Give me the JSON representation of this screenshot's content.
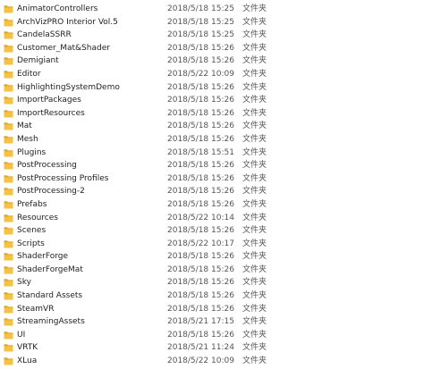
{
  "folder_icon": "folder-icon",
  "colors": {
    "folder_body": "#f5c242",
    "folder_back": "#e2a52b",
    "text": "#222222",
    "meta_text": "#555555",
    "hover": "#e5f3ff"
  },
  "files": [
    {
      "name": "AnimatorControllers",
      "date": "2018/5/18 15:25",
      "type": "文件夹"
    },
    {
      "name": "ArchVizPRO Interior Vol.5",
      "date": "2018/5/18 15:25",
      "type": "文件夹"
    },
    {
      "name": "CandelaSSRR",
      "date": "2018/5/18 15:25",
      "type": "文件夹"
    },
    {
      "name": "Customer_Mat&Shader",
      "date": "2018/5/18 15:26",
      "type": "文件夹"
    },
    {
      "name": "Demigiant",
      "date": "2018/5/18 15:26",
      "type": "文件夹"
    },
    {
      "name": "Editor",
      "date": "2018/5/22 10:09",
      "type": "文件夹"
    },
    {
      "name": "HighlightingSystemDemo",
      "date": "2018/5/18 15:26",
      "type": "文件夹"
    },
    {
      "name": "ImportPackages",
      "date": "2018/5/18 15:26",
      "type": "文件夹"
    },
    {
      "name": "ImportResources",
      "date": "2018/5/18 15:26",
      "type": "文件夹"
    },
    {
      "name": "Mat",
      "date": "2018/5/18 15:26",
      "type": "文件夹"
    },
    {
      "name": "Mesh",
      "date": "2018/5/18 15:26",
      "type": "文件夹"
    },
    {
      "name": "Plugins",
      "date": "2018/5/18 15:51",
      "type": "文件夹"
    },
    {
      "name": "PostProcessing",
      "date": "2018/5/18 15:26",
      "type": "文件夹"
    },
    {
      "name": "PostProcessing Profiles",
      "date": "2018/5/18 15:26",
      "type": "文件夹"
    },
    {
      "name": "PostProcessing-2",
      "date": "2018/5/18 15:26",
      "type": "文件夹"
    },
    {
      "name": "Prefabs",
      "date": "2018/5/18 15:26",
      "type": "文件夹"
    },
    {
      "name": "Resources",
      "date": "2018/5/22 10:14",
      "type": "文件夹"
    },
    {
      "name": "Scenes",
      "date": "2018/5/18 15:26",
      "type": "文件夹"
    },
    {
      "name": "Scripts",
      "date": "2018/5/22 10:17",
      "type": "文件夹"
    },
    {
      "name": "ShaderForge",
      "date": "2018/5/18 15:26",
      "type": "文件夹"
    },
    {
      "name": "ShaderForgeMat",
      "date": "2018/5/18 15:26",
      "type": "文件夹"
    },
    {
      "name": "Sky",
      "date": "2018/5/18 15:26",
      "type": "文件夹"
    },
    {
      "name": "Standard Assets",
      "date": "2018/5/18 15:26",
      "type": "文件夹"
    },
    {
      "name": "SteamVR",
      "date": "2018/5/18 15:26",
      "type": "文件夹"
    },
    {
      "name": "StreamingAssets",
      "date": "2018/5/21 17:15",
      "type": "文件夹"
    },
    {
      "name": "UI",
      "date": "2018/5/18 15:26",
      "type": "文件夹"
    },
    {
      "name": "VRTK",
      "date": "2018/5/21 11:24",
      "type": "文件夹"
    },
    {
      "name": "XLua",
      "date": "2018/5/22 10:09",
      "type": "文件夹"
    }
  ]
}
